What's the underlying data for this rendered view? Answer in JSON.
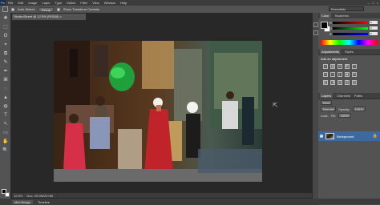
{
  "app": {
    "logo": "Ps"
  },
  "menu": [
    "File",
    "Edit",
    "Image",
    "Layer",
    "Type",
    "Select",
    "Filter",
    "View",
    "Window",
    "Help"
  ],
  "window_controls": [
    "–",
    "□",
    "×"
  ],
  "options": {
    "auto_select": "Auto-Select:",
    "group": "Group",
    "show_transform": "Show Transform Controls",
    "workspace": "Essentials"
  },
  "document": {
    "tab_title": "SkuthoStreet @ 12.5% (RGB/8) ×",
    "zoom": "12.5%",
    "doc_size": "Doc: 29.0M/29.0M"
  },
  "bottom_tabs": [
    "Mini Bridge",
    "Timeline"
  ],
  "color_panel": {
    "tabs": [
      "Color",
      "Swatches"
    ],
    "channels": [
      {
        "label": "R",
        "value": "0",
        "color": "#ff0000"
      },
      {
        "label": "G",
        "value": "0",
        "color": "#00ff00"
      },
      {
        "label": "B",
        "value": "0",
        "color": "#0000ff"
      }
    ]
  },
  "adjustments": {
    "tabs": [
      "Adjustments",
      "Styles"
    ],
    "title": "Add an adjustment",
    "row1": [
      "☀",
      "▦",
      "≋",
      "◩",
      "▽"
    ],
    "row2": [
      "⚖",
      "◑",
      "◐",
      "▣",
      "⊞"
    ],
    "row3": [
      "◧",
      "◨",
      "▤",
      "▥",
      "▧"
    ]
  },
  "layers": {
    "tabs": [
      "Layers",
      "Channels",
      "Paths"
    ],
    "kind": "Kind",
    "blend": "Normal",
    "opacity_label": "Opacity:",
    "opacity": "100%",
    "lock_label": "Lock:",
    "fill_label": "Fill:",
    "fill": "100%",
    "layer_name": "Background"
  },
  "tools": [
    "✥",
    "⬚",
    "ʘ",
    "⌖",
    "⧉",
    "✎",
    "✒",
    "⌘",
    "◌",
    "▲",
    "◍",
    "T",
    "↖",
    "▭",
    "✋",
    "🔍"
  ]
}
